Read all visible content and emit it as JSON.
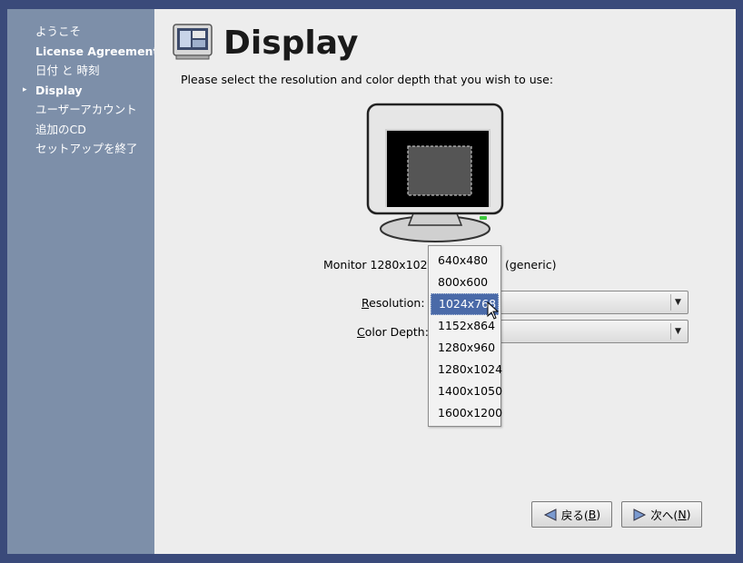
{
  "sidebar": {
    "steps": [
      {
        "label": "ようこそ",
        "bold": false
      },
      {
        "label": "License Agreement",
        "bold": true
      },
      {
        "label": "日付 と 時刻",
        "bold": false
      },
      {
        "label": "Display",
        "bold": true,
        "current": true
      },
      {
        "label": "ユーザーアカウント",
        "bold": false
      },
      {
        "label": "追加のCD",
        "bold": false
      },
      {
        "label": "セットアップを終了",
        "bold": false
      }
    ],
    "current_marker": "▸"
  },
  "page": {
    "title": "Display",
    "instructions": "Please select the resolution and color depth that you wish to use:",
    "monitor_label_prefix": "Monitor 1280x1024",
    "monitor_label_suffix": "(generic)"
  },
  "fields": {
    "resolution": {
      "label_pre": "",
      "label_u": "R",
      "label_post": "esolution:",
      "value": "1024x768"
    },
    "color_depth": {
      "label_pre": "",
      "label_u": "C",
      "label_post": "olor Depth:",
      "value": ""
    }
  },
  "resolution_options": [
    "640x480",
    "800x600",
    "1024x768",
    "1152x864",
    "1280x960",
    "1280x1024",
    "1400x1050",
    "1600x1200"
  ],
  "selected_resolution_index": 2,
  "buttons": {
    "back": {
      "label_pre": "戻る(",
      "label_u": "B",
      "label_post": ")"
    },
    "next": {
      "label_pre": "次へ(",
      "label_u": "N",
      "label_post": ")"
    }
  },
  "icons": {
    "display_title": "display-settings-icon",
    "back": "back-arrow-icon",
    "next": "next-arrow-icon",
    "combo_arrow": "chevron-down-icon",
    "cursor": "mouse-pointer-icon"
  },
  "colors": {
    "sidebar_bg": "#7d8fa9",
    "main_bg": "#ededed",
    "selection": "#4a6aa8"
  }
}
